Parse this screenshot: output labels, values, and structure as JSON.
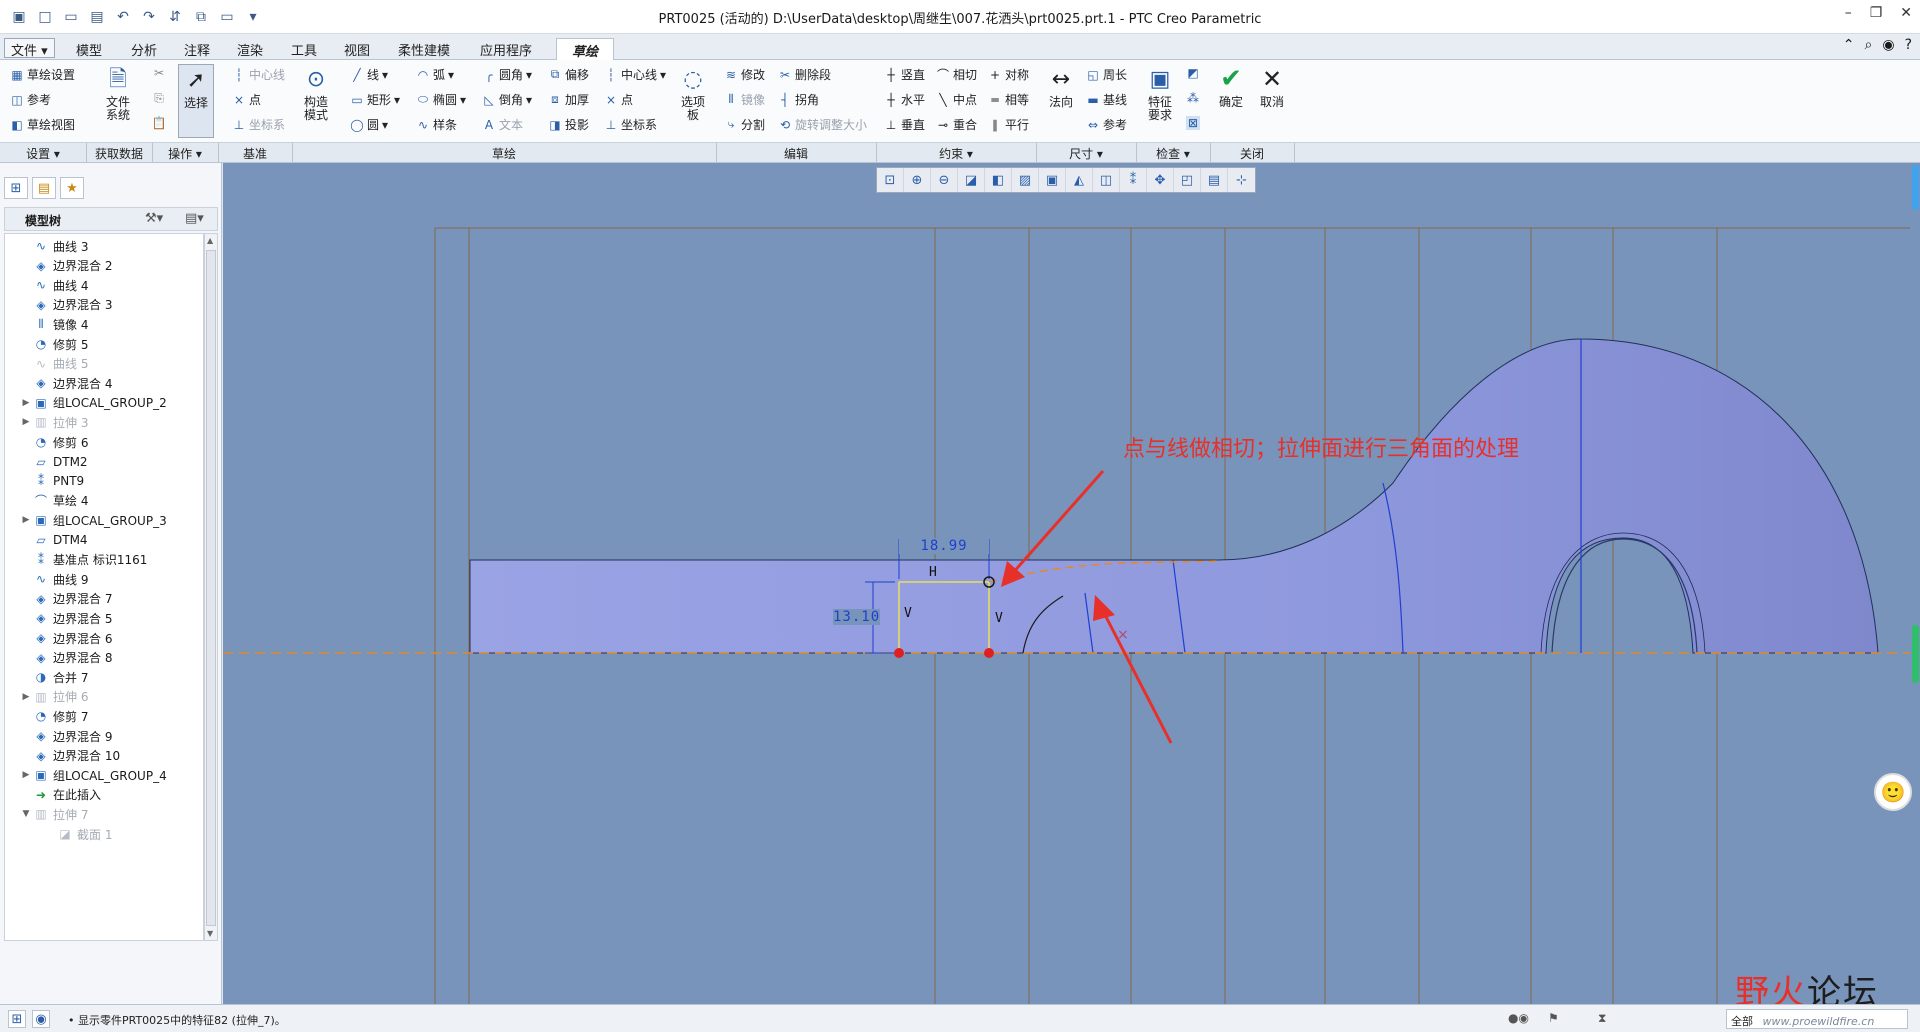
{
  "window": {
    "title": "PRT0025 (活动的) D:\\UserData\\desktop\\周继生\\007.花洒头\\prt0025.prt.1 - PTC Creo Parametric",
    "controls": [
      "minimize-icon",
      "restore-icon",
      "close-icon"
    ]
  },
  "tabs": {
    "file": "文件 ▾",
    "items": [
      "模型",
      "分析",
      "注释",
      "渲染",
      "工具",
      "视图",
      "柔性建模",
      "应用程序"
    ],
    "active": "草绘"
  },
  "ribbon": {
    "setup": {
      "sketch_setup": "草绘设置",
      "reference": "参考",
      "sketch_view": "草绘视图"
    },
    "get_data": {
      "file_system_line1": "文件",
      "file_system_line2": "系统"
    },
    "operations": {
      "select": "选择"
    },
    "datum": {
      "centerline": "中心线",
      "point": "点",
      "coord": "坐标系"
    },
    "sketch": {
      "construction_mode_1": "构造",
      "construction_mode_2": "模式",
      "line": "线",
      "rectangle": "矩形",
      "circle": "圆",
      "arc": "弧",
      "ellipse": "椭圆",
      "spline": "样条",
      "fillet": "圆角",
      "chamfer": "倒角",
      "text": "文本",
      "offset": "偏移",
      "thicken": "加厚",
      "project": "投影",
      "centerline": "中心线",
      "point": "点",
      "coord": "坐标系",
      "palette_1": "选项",
      "palette_2": "板"
    },
    "editing": {
      "modify": "修改",
      "delete_segment": "删除段",
      "mirror": "镜像",
      "corner": "拐角",
      "divide": "分割",
      "rotate_resize": "旋转调整大小"
    },
    "constrain": {
      "vertical": "竖直",
      "tangent": "相切",
      "symmetric": "对称",
      "horizontal": "水平",
      "midpoint": "中点",
      "equal": "相等",
      "perpendicular": "垂直",
      "coincident": "重合",
      "parallel": "平行"
    },
    "dimension": {
      "normal": "法向",
      "perimeter": "周长",
      "baseline": "基线",
      "reference": "参考"
    },
    "inspect": {
      "feature_req_1": "特征",
      "feature_req_2": "要求"
    },
    "close": {
      "ok": "确定",
      "cancel": "取消"
    }
  },
  "groups": {
    "setup": "设置 ▾",
    "get_data": "获取数据",
    "operations": "操作 ▾",
    "datum": "基准",
    "sketch": "草绘",
    "editing": "编辑",
    "constrain": "约束 ▾",
    "dimension": "尺寸 ▾",
    "inspect": "检查 ▾",
    "close": "关闭"
  },
  "model_tree": {
    "header": "模型树",
    "items": [
      {
        "label": "曲线 3",
        "icon": "curve-icon",
        "dim": false,
        "expand": ""
      },
      {
        "label": "边界混合 2",
        "icon": "boundary-blend-icon",
        "dim": false,
        "expand": ""
      },
      {
        "label": "曲线 4",
        "icon": "curve-icon",
        "dim": false,
        "expand": ""
      },
      {
        "label": "边界混合 3",
        "icon": "boundary-blend-icon",
        "dim": false,
        "expand": ""
      },
      {
        "label": "镜像 4",
        "icon": "mirror-icon",
        "dim": false,
        "expand": ""
      },
      {
        "label": "修剪 5",
        "icon": "trim-icon",
        "dim": false,
        "expand": ""
      },
      {
        "label": "曲线 5",
        "icon": "curve-icon",
        "dim": true,
        "expand": ""
      },
      {
        "label": "边界混合 4",
        "icon": "boundary-blend-icon",
        "dim": false,
        "expand": ""
      },
      {
        "label": "组LOCAL_GROUP_2",
        "icon": "group-icon",
        "dim": false,
        "expand": "▶"
      },
      {
        "label": "拉伸 3",
        "icon": "extrude-icon",
        "dim": true,
        "expand": "▶"
      },
      {
        "label": "修剪 6",
        "icon": "trim-icon",
        "dim": false,
        "expand": ""
      },
      {
        "label": "DTM2",
        "icon": "datum-plane-icon",
        "dim": false,
        "expand": ""
      },
      {
        "label": "PNT9",
        "icon": "datum-point-icon",
        "dim": false,
        "expand": ""
      },
      {
        "label": "草绘 4",
        "icon": "sketch-icon",
        "dim": false,
        "expand": ""
      },
      {
        "label": "组LOCAL_GROUP_3",
        "icon": "group-icon",
        "dim": false,
        "expand": "▶"
      },
      {
        "label": "DTM4",
        "icon": "datum-plane-icon",
        "dim": false,
        "expand": ""
      },
      {
        "label": "基准点 标识1161",
        "icon": "datum-point-icon",
        "dim": false,
        "expand": ""
      },
      {
        "label": "曲线 9",
        "icon": "curve-icon",
        "dim": false,
        "expand": ""
      },
      {
        "label": "边界混合 7",
        "icon": "boundary-blend-icon",
        "dim": false,
        "expand": ""
      },
      {
        "label": "边界混合 5",
        "icon": "boundary-blend-icon",
        "dim": false,
        "expand": ""
      },
      {
        "label": "边界混合 6",
        "icon": "boundary-blend-icon",
        "dim": false,
        "expand": ""
      },
      {
        "label": "边界混合 8",
        "icon": "boundary-blend-icon",
        "dim": false,
        "expand": ""
      },
      {
        "label": "合并 7",
        "icon": "merge-icon",
        "dim": false,
        "expand": ""
      },
      {
        "label": "拉伸 6",
        "icon": "extrude-icon",
        "dim": true,
        "expand": "▶"
      },
      {
        "label": "修剪 7",
        "icon": "trim-icon",
        "dim": false,
        "expand": ""
      },
      {
        "label": "边界混合 9",
        "icon": "boundary-blend-icon",
        "dim": false,
        "expand": ""
      },
      {
        "label": "边界混合 10",
        "icon": "boundary-blend-icon",
        "dim": false,
        "expand": ""
      },
      {
        "label": "组LOCAL_GROUP_4",
        "icon": "group-icon",
        "dim": false,
        "expand": "▶"
      },
      {
        "label": "在此插入",
        "icon": "insert-here-icon",
        "dim": false,
        "expand": ""
      },
      {
        "label": "拉伸 7",
        "icon": "extrude-icon",
        "dim": true,
        "expand": "▼"
      },
      {
        "label": "截面 1",
        "icon": "section-icon",
        "dim": true,
        "expand": "",
        "indent": true
      }
    ]
  },
  "canvas": {
    "annotation": "点与线做相切；拉伸面进行三角面的处理",
    "dimension_width": "18.99",
    "dimension_height": "13.10",
    "constraint_h": "H",
    "constraint_v1": "V",
    "constraint_v2": "V"
  },
  "status": {
    "message": "• 显示零件PRT0025中的特征82 (拉伸_7)。",
    "filter": "全部"
  },
  "watermark": {
    "name_part1": "野火",
    "name_part2": "论坛",
    "url": "www.proewildfire.cn"
  },
  "colors": {
    "canvas_bg": "#7894bb",
    "surface": "#8d98dc",
    "accent": "#2a5ea8",
    "annotation": "#e8302a"
  }
}
